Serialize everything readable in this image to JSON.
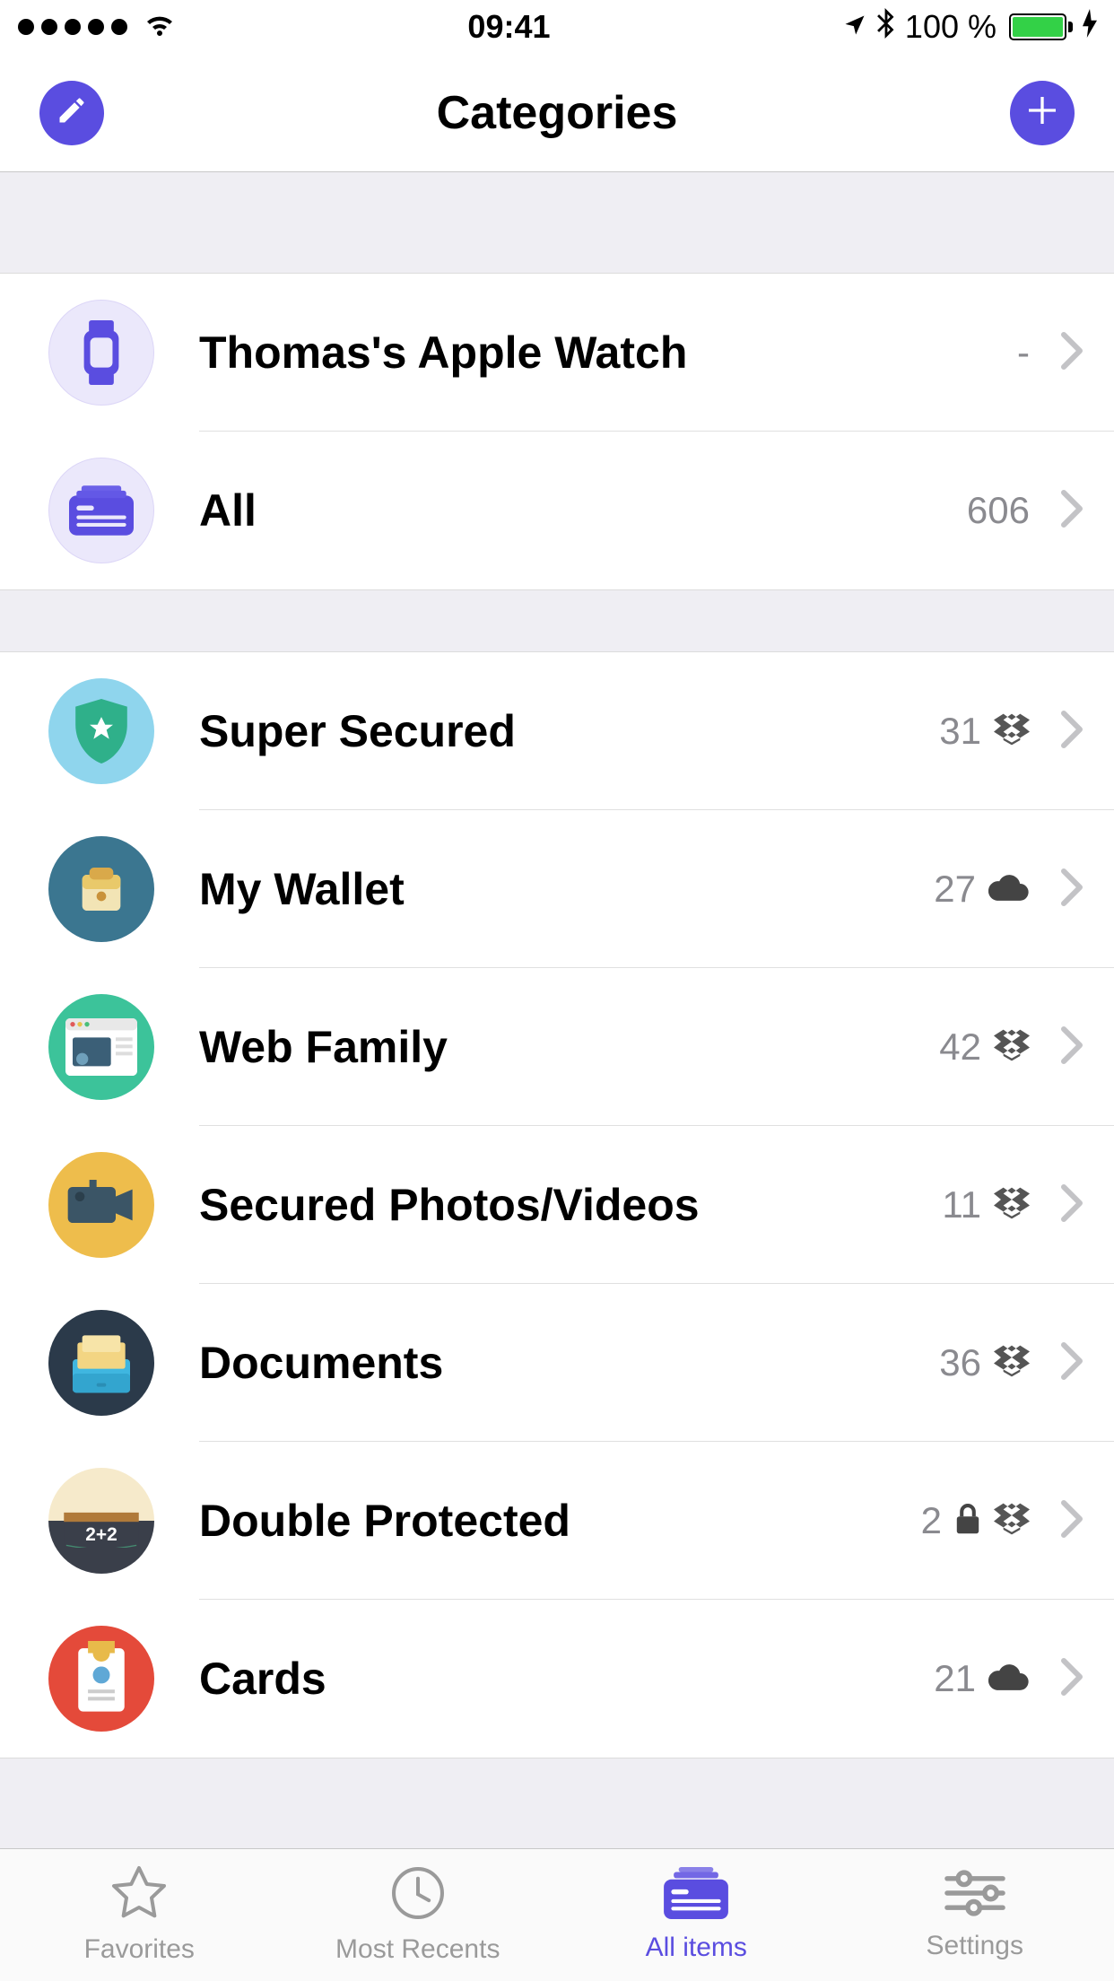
{
  "status": {
    "time": "09:41",
    "battery_text": "100 %"
  },
  "nav": {
    "title": "Categories"
  },
  "section_top": [
    {
      "label": "Thomas's Apple Watch",
      "count": "-",
      "sync": [],
      "avatar": "watch"
    },
    {
      "label": "All",
      "count": "606",
      "sync": [],
      "avatar": "all"
    }
  ],
  "section_main": [
    {
      "label": "Super Secured",
      "count": "31",
      "sync": [
        "dropbox"
      ],
      "avatar": "shield"
    },
    {
      "label": "My Wallet",
      "count": "27",
      "sync": [
        "cloud"
      ],
      "avatar": "wallet"
    },
    {
      "label": "Web Family",
      "count": "42",
      "sync": [
        "dropbox"
      ],
      "avatar": "web"
    },
    {
      "label": "Secured Photos/Videos",
      "count": "11",
      "sync": [
        "dropbox"
      ],
      "avatar": "camera"
    },
    {
      "label": "Documents",
      "count": "36",
      "sync": [
        "dropbox"
      ],
      "avatar": "docs"
    },
    {
      "label": "Double Protected",
      "count": "2",
      "sync": [
        "lock",
        "dropbox"
      ],
      "avatar": "board"
    },
    {
      "label": "Cards",
      "count": "21",
      "sync": [
        "cloud"
      ],
      "avatar": "cards"
    }
  ],
  "tabs": [
    {
      "label": "Favorites",
      "icon": "star",
      "active": false
    },
    {
      "label": "Most Recents",
      "icon": "clock",
      "active": false
    },
    {
      "label": "All items",
      "icon": "allitems",
      "active": true
    },
    {
      "label": "Settings",
      "icon": "sliders",
      "active": false
    }
  ]
}
